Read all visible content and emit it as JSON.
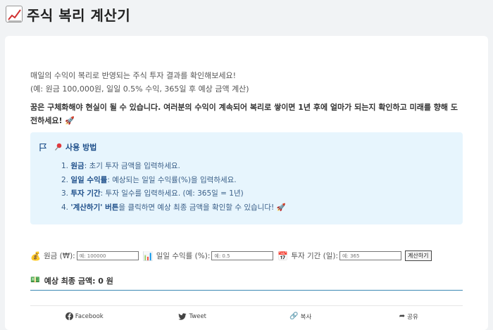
{
  "header": {
    "title": "주식 복리 계산기",
    "icon": "chart-increasing-icon"
  },
  "intro": {
    "line1": "매일의 수익이 복리로 반영되는 주식 투자 결과를 확인해보세요!",
    "line2": "(예: 원금 100,000원, 일일 0.5% 수익, 365일 후 예상 금액 계산)"
  },
  "motivation": {
    "text": "꿈은 구체화해야 현실이 될 수 있습니다. 여러분의 수익이 계속되어 복리로 쌓이면 1년 후에 얼마가 되는지 확인하고 미래를 향해 도전하세요!",
    "emoji": "🚀"
  },
  "howto": {
    "title": "사용 방법",
    "items": [
      {
        "num": "1.",
        "bold": "원금",
        "rest": ": 초기 투자 금액을 입력하세요."
      },
      {
        "num": "2.",
        "bold": "일일 수익률",
        "rest": ": 예상되는 일일 수익률(%)을 입력하세요."
      },
      {
        "num": "3.",
        "bold": "투자 기간",
        "rest": ": 투자 일수를 입력하세요. (예: 365일 = 1년)"
      },
      {
        "num": "4.",
        "bold": "'계산하기' 버튼",
        "rest": "을 클릭하면 예상 최종 금액을 확인할 수 있습니다! 🚀"
      }
    ]
  },
  "form": {
    "principal_label": "원금 (₩):",
    "principal_placeholder": "예: 100000",
    "rate_label": "일일 수익률 (%):",
    "rate_placeholder": "예: 0.5",
    "days_label": "투자 기간 (일):",
    "days_placeholder": "예: 365",
    "calc_button": "계산하기"
  },
  "result": {
    "text": "예상 최종 금액: 0 원"
  },
  "share": {
    "facebook": "Facebook",
    "tweet": "Tweet",
    "copy": "복사",
    "share": "공유"
  }
}
